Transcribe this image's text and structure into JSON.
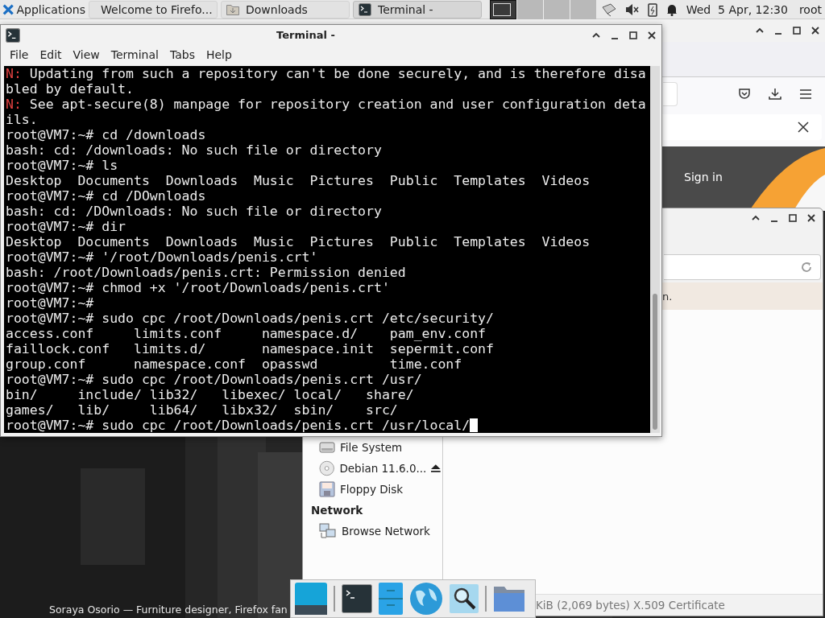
{
  "top_panel": {
    "applications": "Applications",
    "tasks": [
      {
        "label": "Welcome to Firefo...",
        "kind": "browser",
        "selected": false
      },
      {
        "label": "Downloads",
        "kind": "folder",
        "selected": false
      },
      {
        "label": "Terminal -",
        "kind": "terminal",
        "selected": true
      }
    ],
    "workspaces": [
      {
        "selected": true
      },
      {
        "selected": false
      },
      {
        "selected": false
      },
      {
        "selected": false
      }
    ],
    "clock": "Wed  5 Apr, 12:30",
    "user": "root"
  },
  "browser": {
    "sign_in": "Sign in",
    "caption": "Soraya Osorio — Furniture designer, Firefox fan"
  },
  "file_manager": {
    "info": "n.",
    "sidebar": [
      {
        "kind": "drive",
        "label": "File System",
        "eject": false
      },
      {
        "kind": "disc",
        "label": "Debian 11.6.0...",
        "eject": true
      },
      {
        "kind": "floppy",
        "label": "Floppy Disk",
        "eject": false
      },
      {
        "kind": "heading",
        "label": "Network"
      },
      {
        "kind": "network",
        "label": "Browse Network",
        "eject": false
      }
    ],
    "status": "KiB (2,069 bytes) X.509 Certificate"
  },
  "terminal": {
    "title": "Terminal -",
    "menu": [
      "File",
      "Edit",
      "View",
      "Terminal",
      "Tabs",
      "Help"
    ],
    "cursor": true,
    "lines": [
      {
        "kind": "notice",
        "tag": "N:",
        "text": "Updating from such a repository can't be done securely, and is therefore disa"
      },
      {
        "kind": "plain",
        "text": "bled by default."
      },
      {
        "kind": "notice",
        "tag": "N:",
        "text": "See apt-secure(8) manpage for repository creation and user configuration deta"
      },
      {
        "kind": "plain",
        "text": "ils."
      },
      {
        "kind": "plain",
        "text": "root@VM7:~# cd /downloads"
      },
      {
        "kind": "plain",
        "text": "bash: cd: /downloads: No such file or directory"
      },
      {
        "kind": "plain",
        "text": "root@VM7:~# ls"
      },
      {
        "kind": "plain",
        "text": "Desktop  Documents  Downloads  Music  Pictures  Public  Templates  Videos"
      },
      {
        "kind": "plain",
        "text": "root@VM7:~# cd /DOwnloads"
      },
      {
        "kind": "plain",
        "text": "bash: cd: /DOwnloads: No such file or directory"
      },
      {
        "kind": "plain",
        "text": "root@VM7:~# dir"
      },
      {
        "kind": "plain",
        "text": "Desktop  Documents  Downloads  Music  Pictures  Public  Templates  Videos"
      },
      {
        "kind": "plain",
        "text": "root@VM7:~# '/root/Downloads/penis.crt'"
      },
      {
        "kind": "plain",
        "text": "bash: /root/Downloads/penis.crt: Permission denied"
      },
      {
        "kind": "plain",
        "text": "root@VM7:~# chmod +x '/root/Downloads/penis.crt'"
      },
      {
        "kind": "plain",
        "text": "root@VM7:~#"
      },
      {
        "kind": "plain",
        "text": "root@VM7:~# sudo cpc /root/Downloads/penis.crt /etc/security/"
      },
      {
        "kind": "plain",
        "text": "access.conf     limits.conf     namespace.d/    pam_env.conf"
      },
      {
        "kind": "plain",
        "text": "faillock.conf   limits.d/       namespace.init  sepermit.conf"
      },
      {
        "kind": "plain",
        "text": "group.conf      namespace.conf  opasswd         time.conf"
      },
      {
        "kind": "plain",
        "text": "root@VM7:~# sudo cpc /root/Downloads/penis.crt /usr/"
      },
      {
        "kind": "plain",
        "text": "bin/     include/ lib32/   libexec/ local/   share/"
      },
      {
        "kind": "plain",
        "text": "games/   lib/     lib64/   libx32/  sbin/    src/"
      },
      {
        "kind": "plain",
        "text": "root@VM7:~# sudo cpc /root/Downloads/penis.crt /usr/local/"
      }
    ]
  }
}
